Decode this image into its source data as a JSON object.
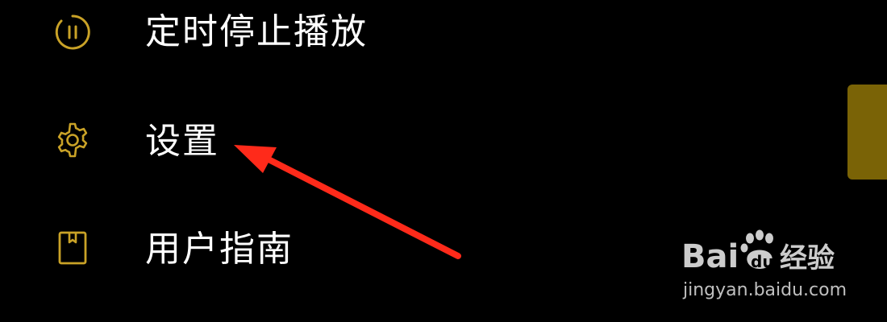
{
  "menu": {
    "items": [
      {
        "label": "定时停止播放",
        "icon": "timer-pause-icon"
      },
      {
        "label": "设置",
        "icon": "gear-icon"
      },
      {
        "label": "用户指南",
        "icon": "book-icon"
      }
    ]
  },
  "colors": {
    "background": "#000000",
    "text": "#ffffff",
    "icon_accent": "#c9a227",
    "side_tab": "#7a6306",
    "annotation_arrow": "#ff2a1a"
  },
  "watermark": {
    "brand": "Bai du 经验",
    "url": "jingyan.baidu.com"
  }
}
